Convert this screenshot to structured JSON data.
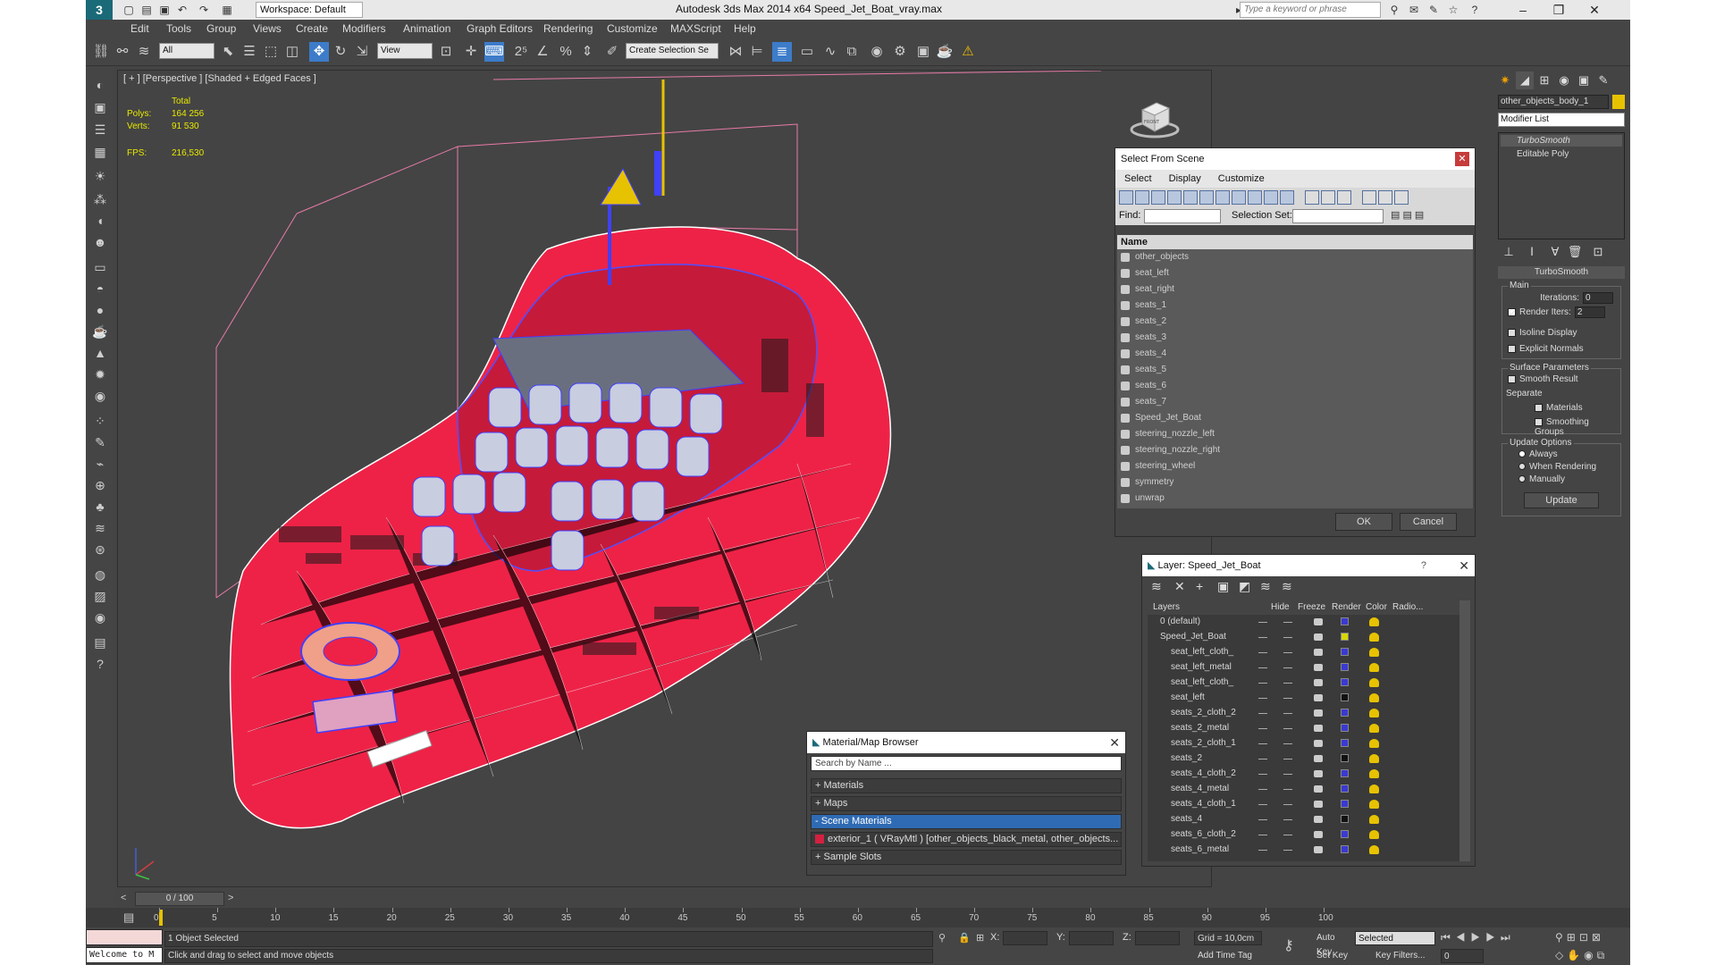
{
  "app": {
    "window_title": "Autodesk 3ds Max  2014 x64     Speed_Jet_Boat_vray.max",
    "workspace": "Workspace: Default",
    "search_placeholder": "Type a keyword or phrase"
  },
  "menu": [
    "Edit",
    "Tools",
    "Group",
    "Views",
    "Create",
    "Modifiers",
    "Animation",
    "Graph Editors",
    "Rendering",
    "Customize",
    "MAXScript",
    "Help"
  ],
  "toolbar": {
    "filter": "All",
    "ref_coord": "View",
    "selection_set": "Create Selection Se"
  },
  "viewport": {
    "label": "[ + ] [Perspective ] [Shaded + Edged Faces ]",
    "stats": {
      "total_label": "Total",
      "polys_label": "Polys:",
      "polys": "164 256",
      "verts_label": "Verts:",
      "verts": "91 530",
      "fps_label": "FPS:",
      "fps": "216,530"
    },
    "viewcube_label": "FRONT"
  },
  "select_from_scene": {
    "title": "Select From Scene",
    "menus": [
      "Select",
      "Display",
      "Customize"
    ],
    "find_label": "Find:",
    "selection_set_label": "Selection Set:",
    "column": "Name",
    "items": [
      "other_objects",
      "seat_left",
      "seat_right",
      "seats_1",
      "seats_2",
      "seats_3",
      "seats_4",
      "seats_5",
      "seats_6",
      "seats_7",
      "Speed_Jet_Boat",
      "steering_nozzle_left",
      "steering_nozzle_right",
      "steering_wheel",
      "symmetry",
      "unwrap"
    ],
    "ok": "OK",
    "cancel": "Cancel"
  },
  "layer_manager": {
    "title": "Layer: Speed_Jet_Boat",
    "help": "?",
    "columns": [
      "Layers",
      "Hide",
      "Freeze",
      "Render",
      "Color",
      "Radio..."
    ],
    "rows": [
      {
        "name": "0 (default)",
        "indent": 1,
        "color": "#3a3ad0"
      },
      {
        "name": "Speed_Jet_Boat",
        "indent": 1,
        "color": "#d8d800"
      },
      {
        "name": "seat_left_cloth_",
        "indent": 2,
        "color": "#3a3ad0"
      },
      {
        "name": "seat_left_metal",
        "indent": 2,
        "color": "#3a3ad0"
      },
      {
        "name": "seat_left_cloth_",
        "indent": 2,
        "color": "#3a3ad0"
      },
      {
        "name": "seat_left",
        "indent": 2,
        "color": "#111111"
      },
      {
        "name": "seats_2_cloth_2",
        "indent": 2,
        "color": "#3a3ad0"
      },
      {
        "name": "seats_2_metal",
        "indent": 2,
        "color": "#3a3ad0"
      },
      {
        "name": "seats_2_cloth_1",
        "indent": 2,
        "color": "#3a3ad0"
      },
      {
        "name": "seats_2",
        "indent": 2,
        "color": "#111111"
      },
      {
        "name": "seats_4_cloth_2",
        "indent": 2,
        "color": "#3a3ad0"
      },
      {
        "name": "seats_4_metal",
        "indent": 2,
        "color": "#3a3ad0"
      },
      {
        "name": "seats_4_cloth_1",
        "indent": 2,
        "color": "#3a3ad0"
      },
      {
        "name": "seats_4",
        "indent": 2,
        "color": "#111111"
      },
      {
        "name": "seats_6_cloth_2",
        "indent": 2,
        "color": "#3a3ad0"
      },
      {
        "name": "seats_6_metal",
        "indent": 2,
        "color": "#3a3ad0"
      }
    ]
  },
  "material_browser": {
    "title": "Material/Map Browser",
    "search": "Search by Name ...",
    "groups": [
      "+ Materials",
      "+ Maps",
      "- Scene Materials"
    ],
    "scene_item": "exterior_1  ( VRayMtl )  [other_objects_black_metal, other_objects...",
    "sample": "+ Sample Slots"
  },
  "command_panel": {
    "object_name": "other_objects_body_1",
    "modifier_list": "Modifier List",
    "stack": [
      "TurboSmooth",
      "Editable Poly"
    ],
    "rollout": "TurboSmooth",
    "main": "Main",
    "iterations_label": "Iterations:",
    "iterations": "0",
    "render_iters_label": "Render Iters:",
    "render_iters": "2",
    "isoline": "Isoline Display",
    "explicit": "Explicit Normals",
    "surface": "Surface Parameters",
    "smooth_result": "Smooth Result",
    "separate": "Separate",
    "materials": "Materials",
    "smoothing": "Smoothing Groups",
    "update_options": "Update Options",
    "always": "Always",
    "when_rendering": "When Rendering",
    "manually": "Manually",
    "update": "Update"
  },
  "timeline": {
    "frame": "0 / 100",
    "ticks": [
      "0",
      "5",
      "10",
      "15",
      "20",
      "25",
      "30",
      "35",
      "40",
      "45",
      "50",
      "55",
      "60",
      "65",
      "70",
      "75",
      "80",
      "85",
      "90",
      "95",
      "100"
    ]
  },
  "status": {
    "selected": "1 Object Selected",
    "prompt": "Click and drag to select and move objects",
    "listener": "Welcome to M",
    "x": "X:",
    "y": "Y:",
    "z": "Z:",
    "grid": "Grid = 10,0cm",
    "auto_key": "Auto Key",
    "set_key": "Set Key",
    "key_mode": "Selected",
    "key_filters": "Key Filters...",
    "add_time_tag": "Add Time Tag",
    "frame": "0"
  }
}
